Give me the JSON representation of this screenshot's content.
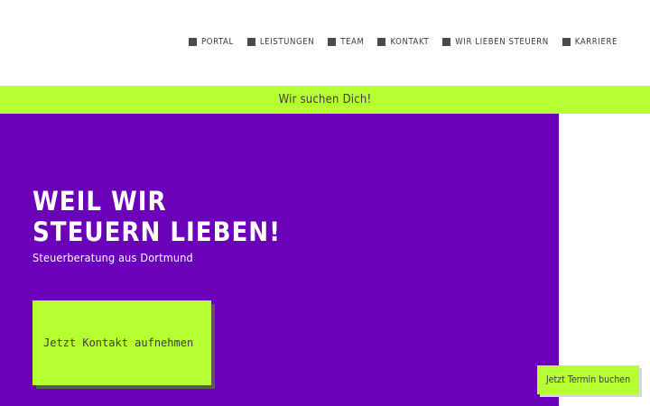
{
  "header": {
    "nav": [
      {
        "label": "Portal",
        "icon": "square-icon"
      },
      {
        "label": "Leistungen",
        "icon": "square-icon"
      },
      {
        "label": "Team",
        "icon": "square-icon"
      },
      {
        "label": "Kontakt",
        "icon": "square-icon"
      },
      {
        "label": "Wir lieben Steuern",
        "icon": "square-icon"
      },
      {
        "label": "Karriere",
        "icon": "square-icon"
      }
    ]
  },
  "banner": {
    "text": "Wir suchen Dich!"
  },
  "hero": {
    "title": "Weil wir Steuern lieben!",
    "subtitle": "Steuerberatung aus Dortmund",
    "cta_label": "Jetzt Kontakt aufnehmen"
  },
  "floating_button": {
    "label": "Jetzt Termin buchen"
  },
  "colors": {
    "accent_green": "#b6ff33",
    "hero_purple": "#6a00b8",
    "nav_text": "#3c3c3c",
    "nav_square": "#4a4a4a"
  }
}
